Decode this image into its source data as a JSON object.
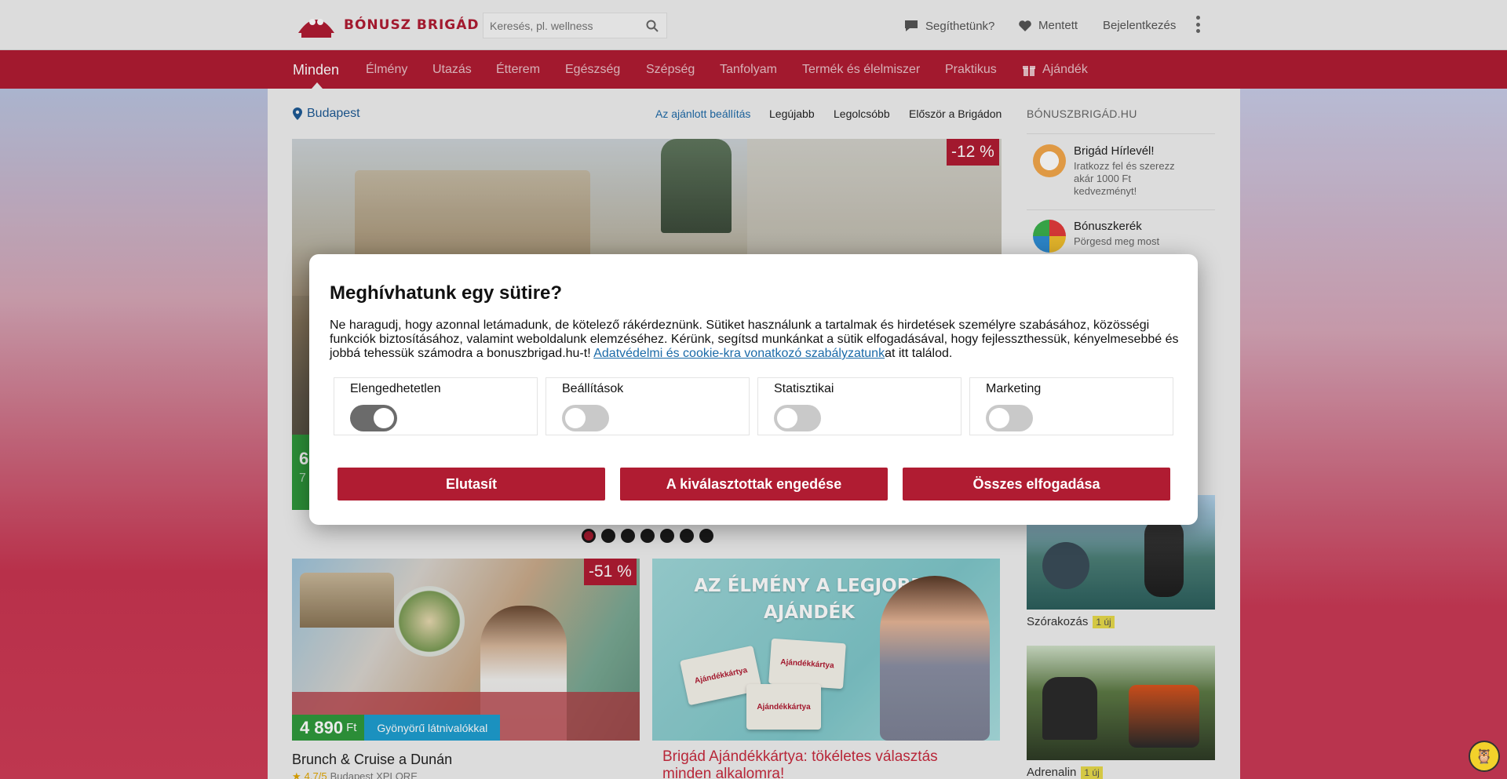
{
  "header": {
    "logo_text": "BÓNUSZ BRIGÁD",
    "search_placeholder": "Keresés, pl. wellness",
    "help_label": "Segíthetünk?",
    "saved_label": "Mentett",
    "login_label": "Bejelentkezés"
  },
  "nav": {
    "items": [
      "Minden",
      "Élmény",
      "Utazás",
      "Étterem",
      "Egészség",
      "Szépség",
      "Tanfolyam",
      "Termék és élelmiszer",
      "Praktikus",
      "Ajándék"
    ],
    "active": "Minden"
  },
  "filter": {
    "location": "Budapest",
    "sort_options": [
      "Az ajánlott beállítás",
      "Legújabb",
      "Legolcsóbb",
      "Először a Brigádon"
    ],
    "active_sort": "Az ajánlott beállítás"
  },
  "hero": {
    "discount": "-12 %",
    "price_main": "6",
    "price_old": "7"
  },
  "carousel": {
    "count": 7,
    "active_index": 0
  },
  "cards": [
    {
      "discount": "-51 %",
      "price": "4 890",
      "currency": "Ft",
      "tag": "Gyönyörű látnivalókkal",
      "title": "Brunch & Cruise a Dunán",
      "rating": "4.7/5",
      "vendor": "Budapest XPLORE"
    },
    {
      "banner_headline": "AZ ÉLMÉNY A LEGJOBB AJÁNDÉK",
      "giftcard_label": "Ajándékkártya",
      "title": "Brigád Ajándékkártya: tökéletes választás minden alkalomra!"
    }
  ],
  "sidebar": {
    "title": "BÓNUSZBRIGÁD.HU",
    "entries": [
      {
        "name": "Brigád Hírlevél!",
        "desc": "Iratkozz fel és szerezz akár 1000 Ft kedvezményt!"
      },
      {
        "name": "Bónuszkerék",
        "desc": "Pörgesd meg most"
      }
    ],
    "tiles": [
      {
        "caption": "Szórakozás",
        "badge": "1 új"
      },
      {
        "caption": "Adrenalin",
        "badge": "1 új"
      }
    ]
  },
  "modal": {
    "title": "Meghívhatunk egy sütire?",
    "text": "Ne haragudj, hogy azonnal letámadunk, de kötelező rákérdeznünk. Sütiket használunk a tartalmak és hirdetések személyre szabásához, közösségi funkciók biztosításához, valamint weboldalunk elemzéséhez. Kérünk, segítsd munkánkat a sütik elfogadásával, hogy fejlesszthessük, kényelmesebbé és jobbá tehessük számodra a bonuszbrigad.hu-t!",
    "link_text": "Adatvédelmi és cookie-kra vonatkozó szabályzatunk",
    "text_after": "at itt találod.",
    "toggles": [
      {
        "label": "Elengedhetetlen",
        "on": true
      },
      {
        "label": "Beállítások",
        "on": false
      },
      {
        "label": "Statisztikai",
        "on": false
      },
      {
        "label": "Marketing",
        "on": false
      }
    ],
    "buttons": {
      "reject": "Elutasít",
      "allow_selected": "A kiválasztottak engedése",
      "accept_all": "Összes elfogadása"
    }
  },
  "colors": {
    "brand": "#b01c32",
    "price_green": "#2f9a3c",
    "tag_blue": "#1e9ed0",
    "link_blue": "#1a6aa8"
  }
}
